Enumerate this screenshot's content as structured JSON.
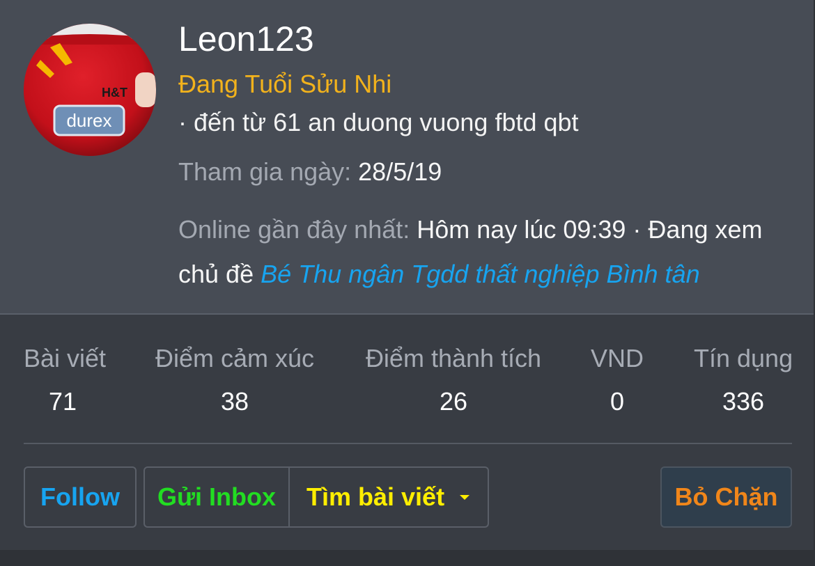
{
  "profile": {
    "username": "Leon123",
    "user_title": "Đang Tuổi Sửu Nhi",
    "from_text": "· đến từ 61 an duong vuong fbtd qbt",
    "join_label": "Tham gia ngày:",
    "join_date": "28/5/19",
    "online_label": "Online gần đây nhất:",
    "online_time": "Hôm nay lúc 09:39 · Đang xem chủ đề",
    "online_thread": "Bé Thu ngân Tgdd thất nghiệp Bình tân",
    "avatar_text": "durex"
  },
  "stats": [
    {
      "label": "Bài viết",
      "value": "71"
    },
    {
      "label": "Điểm cảm xúc",
      "value": "38"
    },
    {
      "label": "Điểm thành tích",
      "value": "26"
    },
    {
      "label": "VND",
      "value": "0"
    },
    {
      "label": "Tín dụng",
      "value": "336"
    }
  ],
  "actions": {
    "follow": "Follow",
    "inbox": "Gửi Inbox",
    "find_posts": "Tìm bài viết",
    "unblock": "Bỏ Chặn"
  },
  "colors": {
    "header_bg": "#474c55",
    "stats_bg": "#383c43",
    "title_gold": "#f2b21c",
    "link_blue": "#17a4f0",
    "inbox_green": "#22dd22",
    "search_yellow": "#ffee00",
    "unblock_orange": "#f0861a"
  },
  "icons": {
    "dropdown": "caret-down-icon"
  }
}
